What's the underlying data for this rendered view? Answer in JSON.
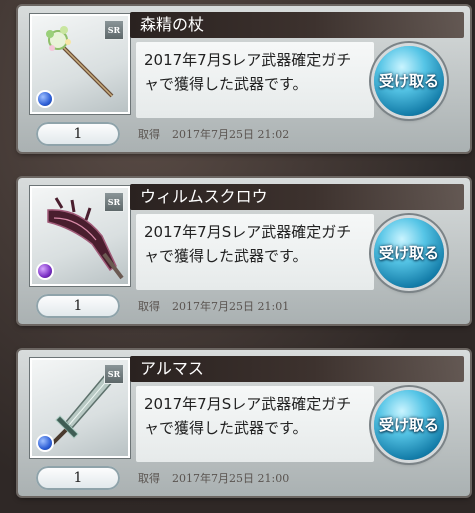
{
  "items": [
    {
      "name": "森精の杖",
      "rarity": "SR",
      "element_color": "#2e5fd6",
      "weapon_icon": "staff-icon",
      "description": "2017年7月Sレア武器確定ガチャで獲得した武器です。",
      "quantity": "1",
      "date_label": "取得",
      "date": "2017年7月25日 21:02",
      "button_label": "受け取る"
    },
    {
      "name": "ウィルムスクロウ",
      "rarity": "SR",
      "element_color": "#7a2fc4",
      "weapon_icon": "claw-blade-icon",
      "description": "2017年7月Sレア武器確定ガチャで獲得した武器です。",
      "quantity": "1",
      "date_label": "取得",
      "date": "2017年7月25日 21:01",
      "button_label": "受け取る"
    },
    {
      "name": "アルマス",
      "rarity": "SR",
      "element_color": "#2e5fd6",
      "weapon_icon": "sword-icon",
      "description": "2017年7月Sレア武器確定ガチャで獲得した武器です。",
      "quantity": "1",
      "date_label": "取得",
      "date": "2017年7月25日 21:00",
      "button_label": "受け取る"
    }
  ]
}
